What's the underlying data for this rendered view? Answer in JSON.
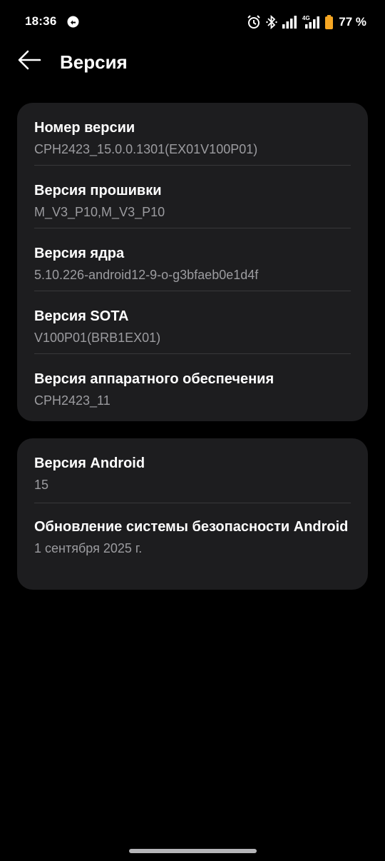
{
  "status_bar": {
    "time": "18:36",
    "battery_percent": "77 %",
    "network_label": "4G",
    "icons": [
      "notification-app-icon",
      "alarm-icon",
      "bluetooth-icon",
      "signal-icon",
      "signal-4g-icon",
      "battery-icon"
    ],
    "battery_color": "#f5a623"
  },
  "header": {
    "title": "Версия",
    "back_icon": "arrow-left-icon"
  },
  "card1": {
    "rows": [
      {
        "title": "Номер версии",
        "value": "CPH2423_15.0.0.1301(EX01V100P01)"
      },
      {
        "title": "Версия прошивки",
        "value": "M_V3_P10,M_V3_P10"
      },
      {
        "title": "Версия ядра",
        "value": "5.10.226-android12-9-o-g3bfaeb0e1d4f"
      },
      {
        "title": "Версия SOTA",
        "value": "V100P01(BRB1EX01)"
      },
      {
        "title": "Версия аппаратного обеспечения",
        "value": "CPH2423_11"
      }
    ]
  },
  "card2": {
    "rows": [
      {
        "title": "Версия Android",
        "value": "15"
      },
      {
        "title": "Обновление системы безопасности Android",
        "value": "1 сентября 2025 г."
      }
    ]
  },
  "colors": {
    "background": "#000000",
    "card": "#1d1d1f",
    "secondary_text": "#9c9ca0",
    "divider": "#38383a"
  }
}
